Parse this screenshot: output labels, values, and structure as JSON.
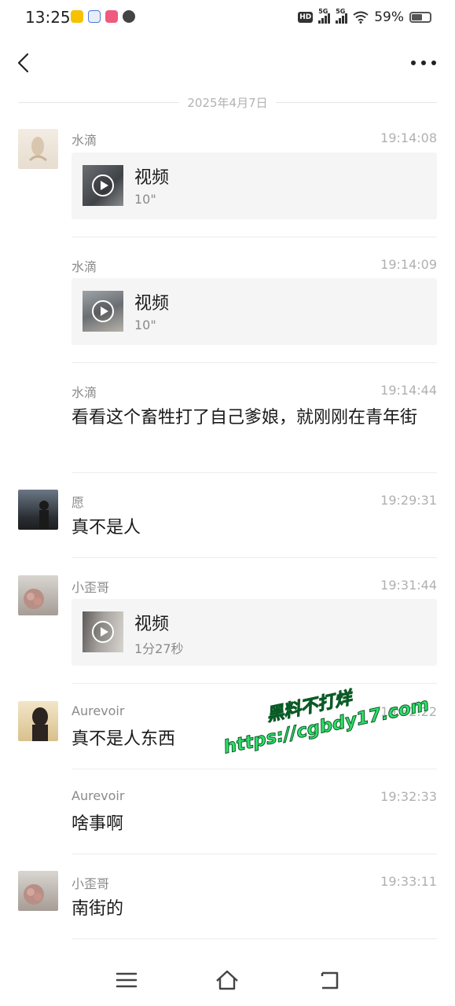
{
  "status_bar": {
    "time": "13:25",
    "hd_label": "HD",
    "network_1": "5G",
    "network_2": "5G",
    "battery_text": "59%",
    "battery_level": 0.59,
    "app_icons": [
      "weibo-icon",
      "app-icon-2",
      "app-icon-3",
      "video-app-icon"
    ]
  },
  "date_label": "2025年4月7日",
  "messages": [
    {
      "sender": "水滴",
      "time": "19:14:08",
      "type": "video",
      "title": "视频",
      "duration": "10\""
    },
    {
      "sender": "水滴",
      "time": "19:14:09",
      "type": "video",
      "title": "视频",
      "duration": "10\""
    },
    {
      "sender": "水滴",
      "time": "19:14:44",
      "type": "text",
      "text": "看看这个畜牲打了自己爹娘，就刚刚在青年街"
    },
    {
      "sender": "愿",
      "time": "19:29:31",
      "type": "text",
      "text": "真不是人"
    },
    {
      "sender": "小歪哥",
      "time": "19:31:44",
      "type": "video",
      "title": "视频",
      "duration": "1分27秒"
    },
    {
      "sender": "Aurevoir",
      "time": "19:32:22",
      "type": "text",
      "text": "真不是人东西"
    },
    {
      "sender": "Aurevoir",
      "time": "19:32:33",
      "type": "text",
      "text": "啥事啊"
    },
    {
      "sender": "小歪哥",
      "time": "19:33:11",
      "type": "text",
      "text": "南街的"
    }
  ],
  "watermark": {
    "line1": "黑料不打烊",
    "line2": "https://cgbdy17.com",
    "color": "#2fe06a"
  },
  "colors": {
    "background": "#ffffff",
    "card_background": "#f5f5f5",
    "secondary_text": "#8a8a8a",
    "time_text": "#b0b0b0"
  }
}
